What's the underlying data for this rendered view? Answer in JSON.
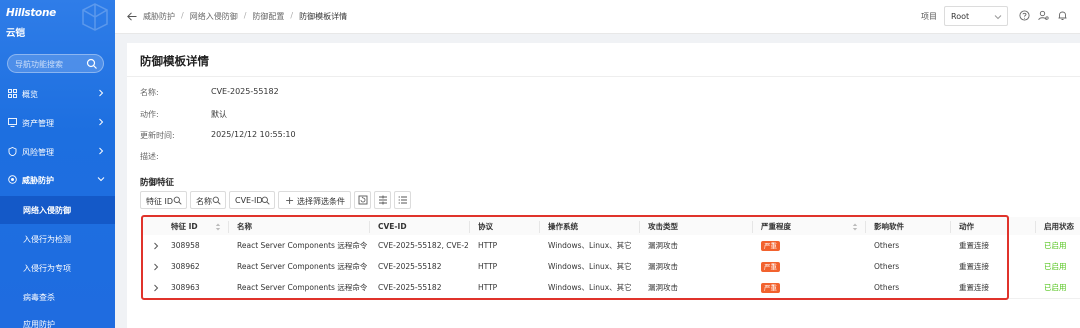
{
  "sidebar": {
    "logo": "Hillstone",
    "logo_sub": "云铠",
    "search_placeholder": "导航功能搜索",
    "items": [
      {
        "label": "概览",
        "icon": "overview-icon"
      },
      {
        "label": "资产管理",
        "icon": "asset-icon"
      },
      {
        "label": "风险管理",
        "icon": "risk-icon"
      },
      {
        "label": "威胁防护",
        "icon": "threat-icon"
      }
    ],
    "sub_items": [
      {
        "label": "网络入侵防御",
        "active": true
      },
      {
        "label": "入侵行为检测",
        "active": false
      },
      {
        "label": "入侵行为专项",
        "active": false
      },
      {
        "label": "病毒查杀",
        "active": false
      },
      {
        "label": "应用防护",
        "active": false
      }
    ]
  },
  "topbar": {
    "breadcrumbs": [
      "威胁防护",
      "网络入侵防御",
      "防御配置",
      "防御模板详情"
    ],
    "project_label": "项目",
    "project_value": "Root"
  },
  "panel": {
    "title": "防御模板详情",
    "info": [
      {
        "key": "名称:",
        "value": "CVE-2025-55182"
      },
      {
        "key": "动作:",
        "value": "默认"
      },
      {
        "key": "更新时间:",
        "value": "2025/12/12 10:55:10"
      },
      {
        "key": "描述:",
        "value": ""
      }
    ],
    "section_title": "防御特征",
    "filters": [
      "特征 ID",
      "名称",
      "CVE-ID"
    ],
    "add_filter_label": "选择筛选条件"
  },
  "table": {
    "headers": [
      "特征 ID",
      "名称",
      "CVE-ID",
      "协议",
      "操作系统",
      "攻击类型",
      "严重程度",
      "影响软件",
      "动作",
      "启用状态"
    ],
    "rows": [
      {
        "id": "308958",
        "name": "React Server Components 远程命令执...",
        "cve": "CVE-2025-55182, CVE-20...",
        "protocol": "HTTP",
        "os": "Windows、Linux、其它",
        "attack": "漏洞攻击",
        "severity": "严重",
        "software": "Others",
        "action": "重置连接",
        "status": "已启用"
      },
      {
        "id": "308962",
        "name": "React Server Components 远程命令执...",
        "cve": "CVE-2025-55182",
        "protocol": "HTTP",
        "os": "Windows、Linux、其它",
        "attack": "漏洞攻击",
        "severity": "严重",
        "software": "Others",
        "action": "重置连接",
        "status": "已启用"
      },
      {
        "id": "308963",
        "name": "React Server Components 远程命令执...",
        "cve": "CVE-2025-55182",
        "protocol": "HTTP",
        "os": "Windows、Linux、其它",
        "attack": "漏洞攻击",
        "severity": "严重",
        "software": "Others",
        "action": "重置连接",
        "status": "已启用"
      }
    ]
  },
  "colors": {
    "sidebar": "#1f6ce0",
    "severity": "#f2622e",
    "status_enabled": "#52c41a",
    "highlight": "#e0332b"
  }
}
